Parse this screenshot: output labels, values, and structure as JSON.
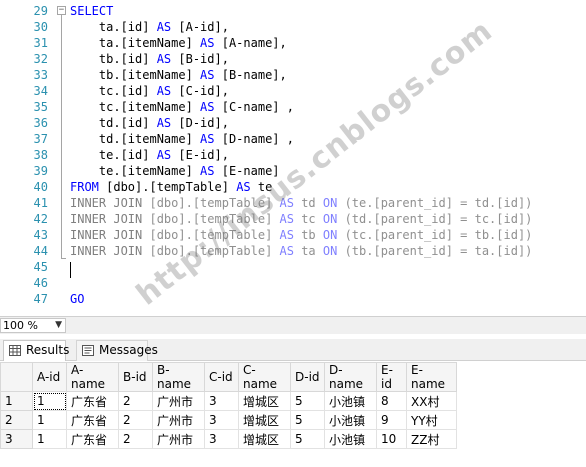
{
  "editor": {
    "line_numbers": [
      "29",
      "30",
      "31",
      "32",
      "33",
      "34",
      "35",
      "36",
      "37",
      "38",
      "39",
      "40",
      "41",
      "42",
      "43",
      "44",
      "45",
      "46",
      "47"
    ],
    "lines": [
      [
        [
          "kw",
          "SELECT"
        ]
      ],
      [
        [
          "txt",
          "    ta.[id] "
        ],
        [
          "kw",
          "AS"
        ],
        [
          "txt",
          " [A-id],"
        ]
      ],
      [
        [
          "txt",
          "    ta.[itemName] "
        ],
        [
          "kw",
          "AS"
        ],
        [
          "txt",
          " [A-name],"
        ]
      ],
      [
        [
          "txt",
          "    tb.[id] "
        ],
        [
          "kw",
          "AS"
        ],
        [
          "txt",
          " [B-id],"
        ]
      ],
      [
        [
          "txt",
          "    tb.[itemName] "
        ],
        [
          "kw",
          "AS"
        ],
        [
          "txt",
          " [B-name],"
        ]
      ],
      [
        [
          "txt",
          "    tc.[id] "
        ],
        [
          "kw",
          "AS"
        ],
        [
          "txt",
          " [C-id],"
        ]
      ],
      [
        [
          "txt",
          "    tc.[itemName] "
        ],
        [
          "kw",
          "AS"
        ],
        [
          "txt",
          " [C-name] ,"
        ]
      ],
      [
        [
          "txt",
          "    td.[id] "
        ],
        [
          "kw",
          "AS"
        ],
        [
          "txt",
          " [D-id],"
        ]
      ],
      [
        [
          "txt",
          "    td.[itemName] "
        ],
        [
          "kw",
          "AS"
        ],
        [
          "txt",
          " [D-name] ,"
        ]
      ],
      [
        [
          "txt",
          "    te.[id] "
        ],
        [
          "kw",
          "AS"
        ],
        [
          "txt",
          " [E-id],"
        ]
      ],
      [
        [
          "txt",
          "    te.[itemName] "
        ],
        [
          "kw",
          "AS"
        ],
        [
          "txt",
          " [E-name]"
        ]
      ],
      [
        [
          "kw",
          "FROM"
        ],
        [
          "txt",
          " [dbo].[tempTable] "
        ],
        [
          "kw",
          "AS"
        ],
        [
          "txt",
          " te"
        ]
      ],
      [
        [
          "gr",
          "INNER JOIN"
        ],
        [
          "txt",
          " [dbo].[tempTable] "
        ],
        [
          "kw",
          "AS"
        ],
        [
          "txt",
          " td "
        ],
        [
          "kw",
          "ON"
        ],
        [
          "txt",
          " (te.[parent_id] = td.[id])"
        ]
      ],
      [
        [
          "gr",
          "INNER JOIN"
        ],
        [
          "txt",
          " [dbo].[tempTable] "
        ],
        [
          "kw",
          "AS"
        ],
        [
          "txt",
          " tc "
        ],
        [
          "kw",
          "ON"
        ],
        [
          "txt",
          " (td.[parent_id] = tc.[id])"
        ]
      ],
      [
        [
          "gr",
          "INNER JOIN"
        ],
        [
          "txt",
          " [dbo].[tempTable] "
        ],
        [
          "kw",
          "AS"
        ],
        [
          "txt",
          " tb "
        ],
        [
          "kw",
          "ON"
        ],
        [
          "txt",
          " (tc.[parent_id] = tb.[id])"
        ]
      ],
      [
        [
          "gr",
          "INNER JOIN"
        ],
        [
          "txt",
          " [dbo].[tempTable] "
        ],
        [
          "kw",
          "AS"
        ],
        [
          "txt",
          " ta "
        ],
        [
          "kw",
          "ON"
        ],
        [
          "txt",
          " (tb.[parent_id] = ta.[id])"
        ]
      ],
      [],
      [],
      [
        [
          "kw",
          "GO"
        ]
      ]
    ],
    "watermark": "http://insus.cnblogs.com"
  },
  "zoom": {
    "value": "100 %"
  },
  "tabs": {
    "results": "Results",
    "messages": "Messages"
  },
  "grid": {
    "columns": [
      "A-id",
      "A-name",
      "B-id",
      "B-name",
      "C-id",
      "C-name",
      "D-id",
      "D-name",
      "E-id",
      "E-name"
    ],
    "rows": [
      {
        "num": "1",
        "cells": [
          "1",
          "广东省",
          "2",
          "广州市",
          "3",
          "增城区",
          "5",
          "小池镇",
          "8",
          "XX村"
        ]
      },
      {
        "num": "2",
        "cells": [
          "1",
          "广东省",
          "2",
          "广州市",
          "3",
          "增城区",
          "5",
          "小池镇",
          "9",
          "YY村"
        ]
      },
      {
        "num": "3",
        "cells": [
          "1",
          "广东省",
          "2",
          "广州市",
          "3",
          "增城区",
          "5",
          "小池镇",
          "10",
          "ZZ村"
        ]
      }
    ]
  },
  "colors": {
    "keyword": "#0000ff",
    "gray_keyword": "#808080",
    "line_number": "#2b91af"
  }
}
